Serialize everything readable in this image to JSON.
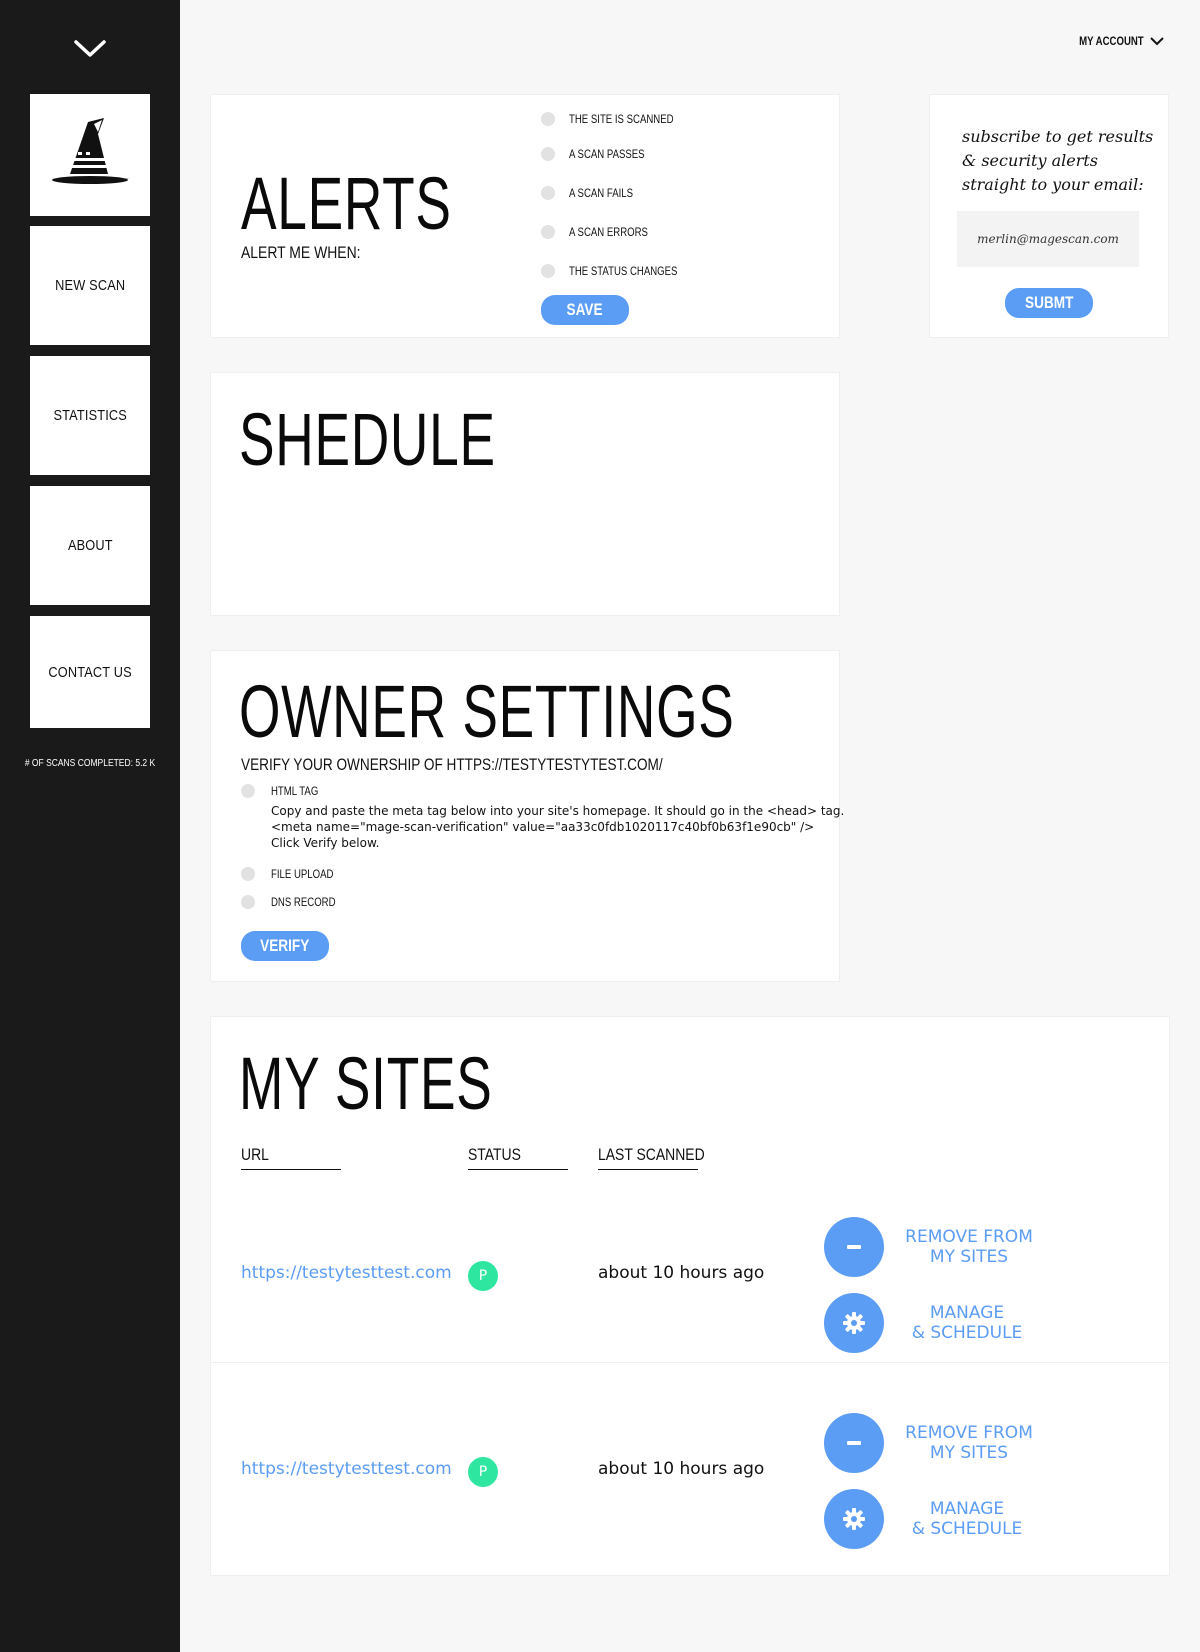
{
  "sidebar": {
    "nav": [
      {
        "label": "NEW SCAN"
      },
      {
        "label": "STATISTICS"
      },
      {
        "label": "ABOUT"
      },
      {
        "label": "CONTACT US"
      }
    ],
    "scans_completed": "# OF SCANS COMPLETED: 5.2 K"
  },
  "header": {
    "account_label": "MY ACCOUNT"
  },
  "alerts": {
    "title": "ALERTS",
    "subtitle": "ALERT ME WHEN:",
    "options": [
      {
        "label": "THE SITE IS SCANNED"
      },
      {
        "label": "A SCAN PASSES"
      },
      {
        "label": "A SCAN FAILS"
      },
      {
        "label": "A SCAN ERRORS"
      },
      {
        "label": "THE STATUS CHANGES"
      }
    ],
    "save_label": "SAVE"
  },
  "subscribe": {
    "text": "subscribe to get results & security alerts straight to your email:",
    "email_value": "merlin@magescan.com",
    "submit_label": "SUBMT"
  },
  "schedule": {
    "title": "SHEDULE"
  },
  "owner": {
    "title": "OWNER SETTINGS",
    "verify_text": "VERIFY YOUR OWNERSHIP OF HTTPS://TESTYTESTYTEST.COM/",
    "options": [
      {
        "label": "HTML TAG"
      },
      {
        "label": "FILE UPLOAD"
      },
      {
        "label": "DNS RECORD"
      }
    ],
    "instructions": [
      "Copy and paste the meta tag below into your site's homepage. It should go in the <head> tag.",
      "<meta name=\"mage-scan-verification\" value=\"aa33c0fdb1020117c40bf0b63f1e90cb\" />",
      "Click Verify below."
    ],
    "verify_label": "VERIFY"
  },
  "mysites": {
    "title": "MY SITES",
    "columns": {
      "url": "URL",
      "status": "STATUS",
      "last": "LAST SCANNED"
    },
    "rows": [
      {
        "url": "https://testytesttest.com",
        "status": "P",
        "last_scanned": "about 10 hours ago",
        "remove_1": "REMOVE FROM",
        "remove_2": "MY SITES",
        "manage_1": "MANAGE",
        "manage_2": "& SCHEDULE"
      },
      {
        "url": "https://testytesttest.com",
        "status": "P",
        "last_scanned": "about 10 hours ago",
        "remove_1": "REMOVE FROM",
        "remove_2": "MY SITES",
        "manage_1": "MANAGE",
        "manage_2": "& SCHEDULE"
      }
    ]
  },
  "colors": {
    "accent": "#5b9cf4",
    "status_pass": "#2ee6a0",
    "sidebar": "#1a1a1a"
  },
  "icons": [
    "chevron-down-icon",
    "wizard-hat-logo",
    "minus-icon",
    "gear-icon"
  ]
}
